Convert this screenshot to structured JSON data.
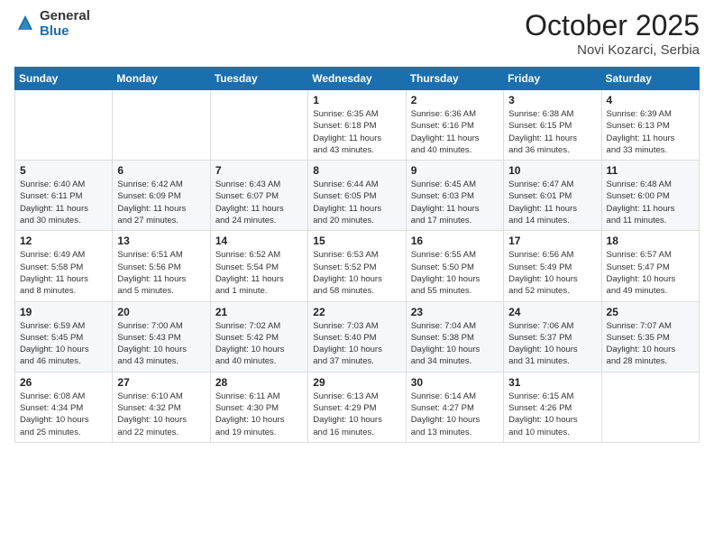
{
  "logo": {
    "general": "General",
    "blue": "Blue"
  },
  "header": {
    "month": "October 2025",
    "location": "Novi Kozarci, Serbia"
  },
  "days_of_week": [
    "Sunday",
    "Monday",
    "Tuesday",
    "Wednesday",
    "Thursday",
    "Friday",
    "Saturday"
  ],
  "weeks": [
    [
      {
        "day": "",
        "info": ""
      },
      {
        "day": "",
        "info": ""
      },
      {
        "day": "",
        "info": ""
      },
      {
        "day": "1",
        "info": "Sunrise: 6:35 AM\nSunset: 6:18 PM\nDaylight: 11 hours\nand 43 minutes."
      },
      {
        "day": "2",
        "info": "Sunrise: 6:36 AM\nSunset: 6:16 PM\nDaylight: 11 hours\nand 40 minutes."
      },
      {
        "day": "3",
        "info": "Sunrise: 6:38 AM\nSunset: 6:15 PM\nDaylight: 11 hours\nand 36 minutes."
      },
      {
        "day": "4",
        "info": "Sunrise: 6:39 AM\nSunset: 6:13 PM\nDaylight: 11 hours\nand 33 minutes."
      }
    ],
    [
      {
        "day": "5",
        "info": "Sunrise: 6:40 AM\nSunset: 6:11 PM\nDaylight: 11 hours\nand 30 minutes."
      },
      {
        "day": "6",
        "info": "Sunrise: 6:42 AM\nSunset: 6:09 PM\nDaylight: 11 hours\nand 27 minutes."
      },
      {
        "day": "7",
        "info": "Sunrise: 6:43 AM\nSunset: 6:07 PM\nDaylight: 11 hours\nand 24 minutes."
      },
      {
        "day": "8",
        "info": "Sunrise: 6:44 AM\nSunset: 6:05 PM\nDaylight: 11 hours\nand 20 minutes."
      },
      {
        "day": "9",
        "info": "Sunrise: 6:45 AM\nSunset: 6:03 PM\nDaylight: 11 hours\nand 17 minutes."
      },
      {
        "day": "10",
        "info": "Sunrise: 6:47 AM\nSunset: 6:01 PM\nDaylight: 11 hours\nand 14 minutes."
      },
      {
        "day": "11",
        "info": "Sunrise: 6:48 AM\nSunset: 6:00 PM\nDaylight: 11 hours\nand 11 minutes."
      }
    ],
    [
      {
        "day": "12",
        "info": "Sunrise: 6:49 AM\nSunset: 5:58 PM\nDaylight: 11 hours\nand 8 minutes."
      },
      {
        "day": "13",
        "info": "Sunrise: 6:51 AM\nSunset: 5:56 PM\nDaylight: 11 hours\nand 5 minutes."
      },
      {
        "day": "14",
        "info": "Sunrise: 6:52 AM\nSunset: 5:54 PM\nDaylight: 11 hours\nand 1 minute."
      },
      {
        "day": "15",
        "info": "Sunrise: 6:53 AM\nSunset: 5:52 PM\nDaylight: 10 hours\nand 58 minutes."
      },
      {
        "day": "16",
        "info": "Sunrise: 6:55 AM\nSunset: 5:50 PM\nDaylight: 10 hours\nand 55 minutes."
      },
      {
        "day": "17",
        "info": "Sunrise: 6:56 AM\nSunset: 5:49 PM\nDaylight: 10 hours\nand 52 minutes."
      },
      {
        "day": "18",
        "info": "Sunrise: 6:57 AM\nSunset: 5:47 PM\nDaylight: 10 hours\nand 49 minutes."
      }
    ],
    [
      {
        "day": "19",
        "info": "Sunrise: 6:59 AM\nSunset: 5:45 PM\nDaylight: 10 hours\nand 46 minutes."
      },
      {
        "day": "20",
        "info": "Sunrise: 7:00 AM\nSunset: 5:43 PM\nDaylight: 10 hours\nand 43 minutes."
      },
      {
        "day": "21",
        "info": "Sunrise: 7:02 AM\nSunset: 5:42 PM\nDaylight: 10 hours\nand 40 minutes."
      },
      {
        "day": "22",
        "info": "Sunrise: 7:03 AM\nSunset: 5:40 PM\nDaylight: 10 hours\nand 37 minutes."
      },
      {
        "day": "23",
        "info": "Sunrise: 7:04 AM\nSunset: 5:38 PM\nDaylight: 10 hours\nand 34 minutes."
      },
      {
        "day": "24",
        "info": "Sunrise: 7:06 AM\nSunset: 5:37 PM\nDaylight: 10 hours\nand 31 minutes."
      },
      {
        "day": "25",
        "info": "Sunrise: 7:07 AM\nSunset: 5:35 PM\nDaylight: 10 hours\nand 28 minutes."
      }
    ],
    [
      {
        "day": "26",
        "info": "Sunrise: 6:08 AM\nSunset: 4:34 PM\nDaylight: 10 hours\nand 25 minutes."
      },
      {
        "day": "27",
        "info": "Sunrise: 6:10 AM\nSunset: 4:32 PM\nDaylight: 10 hours\nand 22 minutes."
      },
      {
        "day": "28",
        "info": "Sunrise: 6:11 AM\nSunset: 4:30 PM\nDaylight: 10 hours\nand 19 minutes."
      },
      {
        "day": "29",
        "info": "Sunrise: 6:13 AM\nSunset: 4:29 PM\nDaylight: 10 hours\nand 16 minutes."
      },
      {
        "day": "30",
        "info": "Sunrise: 6:14 AM\nSunset: 4:27 PM\nDaylight: 10 hours\nand 13 minutes."
      },
      {
        "day": "31",
        "info": "Sunrise: 6:15 AM\nSunset: 4:26 PM\nDaylight: 10 hours\nand 10 minutes."
      },
      {
        "day": "",
        "info": ""
      }
    ]
  ]
}
